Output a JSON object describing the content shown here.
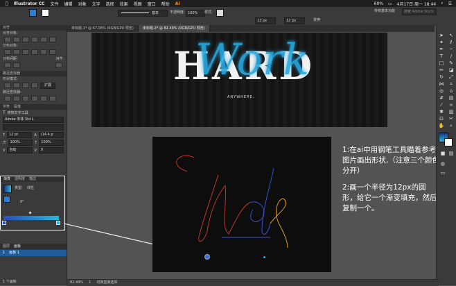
{
  "menubar": {
    "app_name": "Illustrator CC",
    "menus": [
      "文件",
      "编辑",
      "对象",
      "文字",
      "选择",
      "效果",
      "视图",
      "窗口",
      "帮助"
    ],
    "battery": "60%",
    "datetime": "4月17日 周一 18:44"
  },
  "controlbar": {
    "stroke_profile_label": "基本",
    "opacity_label": "不透明度:",
    "opacity_value": "100%",
    "style_label": "样式:",
    "width_label": "12 px",
    "height_label": "12 px",
    "transform_label": "变换",
    "search_placeholder": "搜索 Adobe Stock",
    "workspace": "传统基本功能"
  },
  "left_panel": {
    "align_title": "对齐",
    "align_objects": "对齐对象:",
    "distribute_objects": "分布对象:",
    "distribute_spacing": "分布间距:",
    "align_to": "对齐:",
    "pathfinder_title": "路径查找器",
    "shape_modes": "形状模式:",
    "expand_button": "扩展",
    "pathfinders": "路径查找器:",
    "char_tab": "字符",
    "para_tab": "段落",
    "touch_type": "修饰文字工具",
    "font_name": "Adobe 宋体 Std L",
    "font_size": "12 pt",
    "leading": "(14.4 p",
    "scale_h": "100%",
    "scale_v": "100%",
    "kerning": "自动",
    "tracking": "0"
  },
  "gradient_panel": {
    "tab_gradient": "渐变",
    "tab_transparency": "透明度",
    "tab_stroke": "描边",
    "type_label": "类型:",
    "type_value": "线性",
    "angle_value": "0°"
  },
  "layers_panel": {
    "tab_layers": "图层",
    "tab_artboards": "画板",
    "artboard_item_number": "1",
    "artboard_item_name": "画板 1",
    "footer": "1 个画板"
  },
  "doc_tabs": [
    {
      "label": "未标题-1* @ 67.08% (RGB/GPU 预览)",
      "active": false
    },
    {
      "label": "未标题-2* @ 82.49% (RGB/GPU 预览)",
      "active": true
    }
  ],
  "statusbar": {
    "zoom": "82.49%",
    "artboard": "1",
    "tool_name": "切换直接选择"
  },
  "artwork": {
    "hard_text": "HARD",
    "script_text": "Work",
    "tagline": "ANYWHERE.",
    "trace_text": "Work"
  },
  "annotation": {
    "step1": "1:在ai中用钢笔工具瞄着参考图片画出形状,（注意三个颜色分开）",
    "step2": "2:画一个半径为12px的圆形，给它一个渐变填充，然后复制一个。"
  },
  "colors": {
    "accent_blue": "#29a8e0",
    "trace_red": "#c0392b",
    "trace_blue": "#3b4fd8",
    "trace_orange": "#e0a020"
  }
}
